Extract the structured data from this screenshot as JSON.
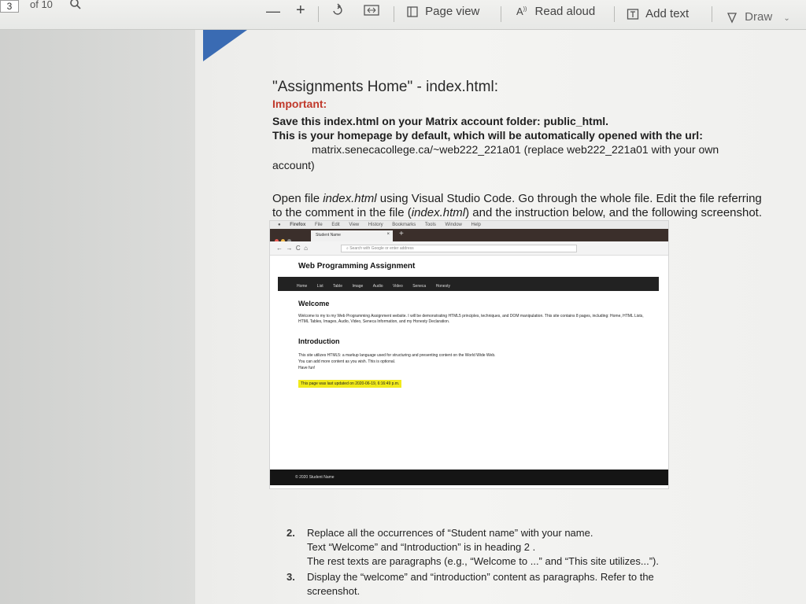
{
  "toolbar": {
    "page_number": "3",
    "page_of": "of 10",
    "page_view_label": "Page view",
    "read_aloud_label": "Read aloud",
    "add_text_label": "Add text",
    "draw_label": "Draw"
  },
  "document": {
    "title": "\"Assignments Home\" - index.html:",
    "important_label": "Important:",
    "line1": "Save this index.html on your Matrix account folder: public_html.",
    "line2": "This is your homepage by default, which will be automatically opened with the url:",
    "line3": "matrix.senecacollege.ca/~web222_221a01 (replace web222_221a01 with your own",
    "line4": "account)",
    "para1_a": "Open file ",
    "para1_file": "index.html",
    "para1_b": " using Visual Studio Code. Go through the whole file. Edit the file referring",
    "para2_a": "to the comment in the file (",
    "para2_file": "index.html",
    "para2_b": ") and the instruction below, and the following screenshot."
  },
  "screenshot": {
    "menu": [
      "Firefox",
      "File",
      "Edit",
      "View",
      "History",
      "Bookmarks",
      "Tools",
      "Window",
      "Help"
    ],
    "tab_title": "Student Name",
    "url_placeholder": "Search with Google or enter address",
    "site_title": "Web Programming Assignment",
    "nav_items": [
      "Home",
      "List",
      "Table",
      "Image",
      "Audio",
      "Video",
      "Seneca",
      "Honesty"
    ],
    "welcome_heading": "Welcome",
    "welcome_text": "Welcome to my to my Web Programming Assignment website. I will be demonstrating HTML5 principles, techniques, and DOM manipulation. This site contains 8 pages, including: Home, HTML Lists, HTML Tables, Images, Audio, Video, Seneca Information, and my Honesty Declaration.",
    "intro_heading": "Introduction",
    "intro_line1": "This site utilizes HTML5: a markup language used for structuring and presenting content on the World Wide Web.",
    "intro_line2": "You can add more content as you wish. This is optional.",
    "intro_line3": "Have fun!",
    "updated_text": "This page was last updated on 2020-06-19, 6:16:49 p.m.",
    "footer_text": "© 2020 Student Name"
  },
  "instructions": {
    "n2": "2.",
    "i2_line1": "Replace all the occurrences of “Student name” with your name.",
    "i2_line2": "Text “Welcome” and “Introduction” is in heading 2 .",
    "i2_line3": "The rest texts are paragraphs (e.g., “Welcome to ...” and “This site utilizes...”).",
    "n3": "3.",
    "i3_line1": "Display the “welcome” and “introduction” content as paragraphs. Refer to the",
    "i3_line2": "screenshot."
  }
}
